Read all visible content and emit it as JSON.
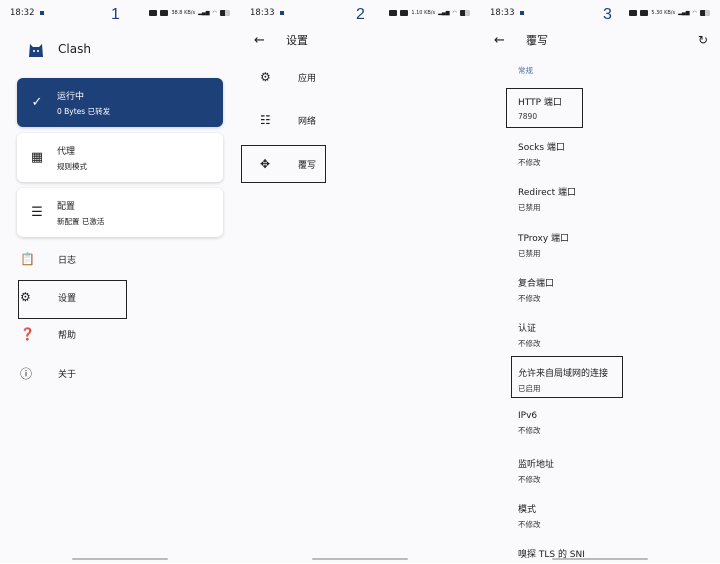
{
  "panels": [
    {
      "number": "1",
      "time": "18:32",
      "speed": "38.8 KB/s",
      "app_title": "Clash",
      "status_card": {
        "title": "运行中",
        "subtitle": "0 Bytes 已转发",
        "color": "#1e4078"
      },
      "proxy_card": {
        "title": "代理",
        "subtitle": "规则模式"
      },
      "profile_card": {
        "title": "配置",
        "subtitle": "新配置 已激活"
      },
      "menu": [
        "日志",
        "设置",
        "帮助",
        "关于"
      ]
    },
    {
      "number": "2",
      "time": "18:33",
      "speed": "1.10 KB/s",
      "title": "设置",
      "items": [
        "应用",
        "网络",
        "覆写"
      ]
    },
    {
      "number": "3",
      "time": "18:33",
      "speed": "5.30 KB/s",
      "title": "覆写",
      "section": "常规",
      "items": [
        {
          "label": "HTTP 端口",
          "value": "7890"
        },
        {
          "label": "Socks 端口",
          "value": "不修改"
        },
        {
          "label": "Redirect 端口",
          "value": "已禁用"
        },
        {
          "label": "TProxy 端口",
          "value": "已禁用"
        },
        {
          "label": "复合端口",
          "value": "不修改"
        },
        {
          "label": "认证",
          "value": "不修改"
        },
        {
          "label": "允许来自局域网的连接",
          "value": "已启用"
        },
        {
          "label": "IPv6",
          "value": "不修改"
        },
        {
          "label": "监听地址",
          "value": "不修改"
        },
        {
          "label": "模式",
          "value": "不修改"
        },
        {
          "label": "嗅探 TLS 的 SNI",
          "value": ""
        }
      ]
    }
  ]
}
